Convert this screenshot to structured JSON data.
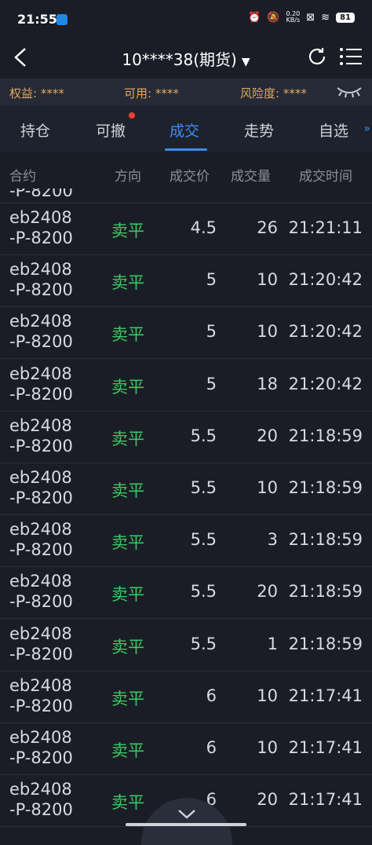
{
  "status": {
    "time": "21:55",
    "netspeed_top": "0.20",
    "netspeed_bottom": "KB/s",
    "battery": "81"
  },
  "header": {
    "account": "10****38(期货)",
    "dropdown_arrow": "▼"
  },
  "info": {
    "equity_label": "权益: ****",
    "available_label": "可用: ****",
    "risk_label": "风险度: ****"
  },
  "tabs": [
    {
      "label": "持仓"
    },
    {
      "label": "可撤"
    },
    {
      "label": "成交"
    },
    {
      "label": "走势"
    },
    {
      "label": "自选"
    }
  ],
  "tabs_more": "»",
  "columns": {
    "contract": "合约",
    "direction": "方向",
    "price": "成交价",
    "volume": "成交量",
    "time": "成交时间"
  },
  "cutoff_row": {
    "contract": "-P-8200"
  },
  "rows": [
    {
      "contract_1": "eb2408",
      "contract_2": "-P-8200",
      "direction": "卖平",
      "price": "4.5",
      "volume": "26",
      "time": "21:21:11"
    },
    {
      "contract_1": "eb2408",
      "contract_2": "-P-8200",
      "direction": "卖平",
      "price": "5",
      "volume": "10",
      "time": "21:20:42"
    },
    {
      "contract_1": "eb2408",
      "contract_2": "-P-8200",
      "direction": "卖平",
      "price": "5",
      "volume": "10",
      "time": "21:20:42"
    },
    {
      "contract_1": "eb2408",
      "contract_2": "-P-8200",
      "direction": "卖平",
      "price": "5",
      "volume": "18",
      "time": "21:20:42"
    },
    {
      "contract_1": "eb2408",
      "contract_2": "-P-8200",
      "direction": "卖平",
      "price": "5.5",
      "volume": "20",
      "time": "21:18:59"
    },
    {
      "contract_1": "eb2408",
      "contract_2": "-P-8200",
      "direction": "卖平",
      "price": "5.5",
      "volume": "10",
      "time": "21:18:59"
    },
    {
      "contract_1": "eb2408",
      "contract_2": "-P-8200",
      "direction": "卖平",
      "price": "5.5",
      "volume": "3",
      "time": "21:18:59"
    },
    {
      "contract_1": "eb2408",
      "contract_2": "-P-8200",
      "direction": "卖平",
      "price": "5.5",
      "volume": "20",
      "time": "21:18:59"
    },
    {
      "contract_1": "eb2408",
      "contract_2": "-P-8200",
      "direction": "卖平",
      "price": "5.5",
      "volume": "1",
      "time": "21:18:59"
    },
    {
      "contract_1": "eb2408",
      "contract_2": "-P-8200",
      "direction": "卖平",
      "price": "6",
      "volume": "10",
      "time": "21:17:41"
    },
    {
      "contract_1": "eb2408",
      "contract_2": "-P-8200",
      "direction": "卖平",
      "price": "6",
      "volume": "10",
      "time": "21:17:41"
    },
    {
      "contract_1": "eb2408",
      "contract_2": "-P-8200",
      "direction": "卖平",
      "price": "6",
      "volume": "20",
      "time": "21:17:41"
    }
  ],
  "colors": {
    "accent": "#3b8cf5",
    "sell_close": "#3cc864",
    "info_text": "#e2a85a",
    "badge": "#ff3b30"
  }
}
